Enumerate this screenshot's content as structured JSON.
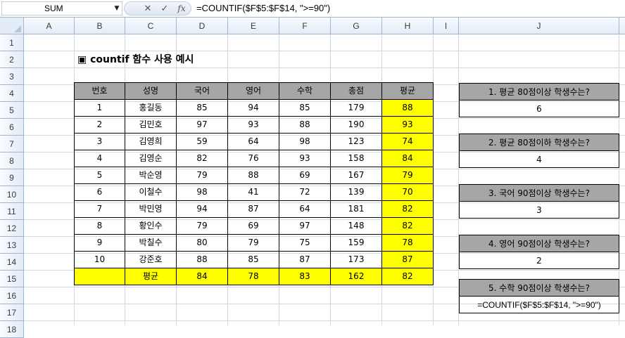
{
  "formula_bar": {
    "name_box": "SUM",
    "cancel_icon": "✕",
    "enter_icon": "✓",
    "fx_label": "fx",
    "formula": "=COUNTIF($F$5:$F$14, \">=90\")"
  },
  "columns": [
    "A",
    "B",
    "C",
    "D",
    "E",
    "F",
    "G",
    "H",
    "I",
    "J"
  ],
  "rows": [
    "1",
    "2",
    "3",
    "4",
    "5",
    "6",
    "7",
    "8",
    "9",
    "10",
    "11",
    "12",
    "13",
    "14",
    "15",
    "16",
    "17",
    "18"
  ],
  "title": "▣ countif 함수 사용 예시",
  "table": {
    "headers": [
      "번호",
      "성명",
      "국어",
      "영어",
      "수학",
      "총점",
      "평균"
    ],
    "rows": [
      [
        "1",
        "홍길동",
        "85",
        "94",
        "85",
        "179",
        "88"
      ],
      [
        "2",
        "김민호",
        "97",
        "93",
        "88",
        "190",
        "93"
      ],
      [
        "3",
        "김영희",
        "59",
        "64",
        "98",
        "123",
        "74"
      ],
      [
        "4",
        "김영순",
        "82",
        "76",
        "93",
        "158",
        "84"
      ],
      [
        "5",
        "박순영",
        "79",
        "88",
        "69",
        "167",
        "79"
      ],
      [
        "6",
        "이철수",
        "98",
        "41",
        "72",
        "139",
        "70"
      ],
      [
        "7",
        "박민영",
        "94",
        "87",
        "64",
        "181",
        "82"
      ],
      [
        "8",
        "황인수",
        "79",
        "69",
        "97",
        "148",
        "82"
      ],
      [
        "9",
        "박칠수",
        "80",
        "79",
        "75",
        "159",
        "78"
      ],
      [
        "10",
        "강준호",
        "88",
        "85",
        "87",
        "173",
        "87"
      ]
    ],
    "avg_row": [
      "",
      "평균",
      "84",
      "78",
      "83",
      "162",
      "82"
    ]
  },
  "questions": [
    {
      "q": "1. 평균 80점이상 학생수는?",
      "a": "6"
    },
    {
      "q": "2. 평균 80점이하 학생수는?",
      "a": "4"
    },
    {
      "q": "3. 국어 90점이상 학생수는?",
      "a": "3"
    },
    {
      "q": "4. 영어 90점이상 학생수는?",
      "a": "2"
    },
    {
      "q": "5. 수학 90점이상 학생수는?",
      "a": "=COUNTIF($F$5:$F$14, \">=90\")"
    }
  ],
  "colors": {
    "header_gray": "#a6a6a6",
    "highlight_yellow": "#ffff00",
    "grid": "#d0d7e5"
  }
}
